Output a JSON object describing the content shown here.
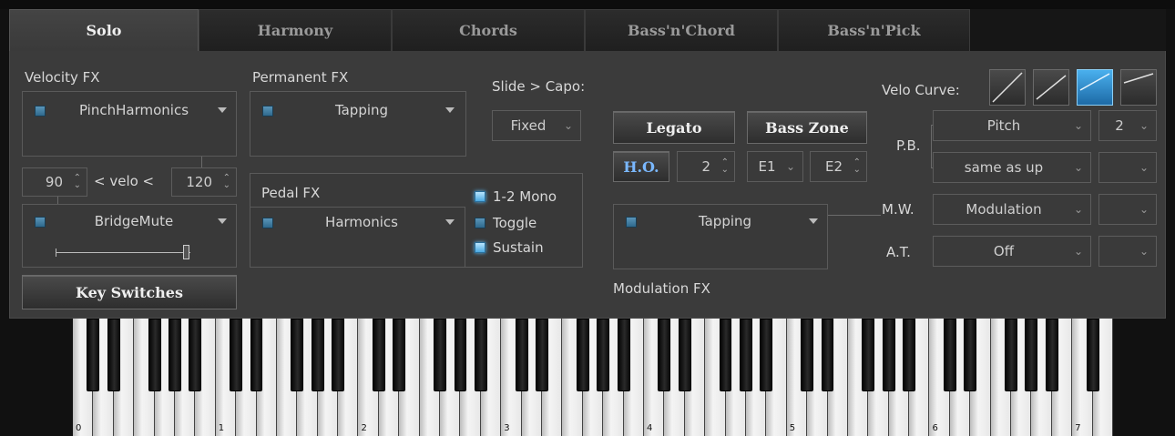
{
  "tabs": [
    {
      "label": "Solo",
      "active": true
    },
    {
      "label": "Harmony",
      "active": false
    },
    {
      "label": "Chords",
      "active": false
    },
    {
      "label": "Bass'n'Chord",
      "active": false
    },
    {
      "label": "Bass'n'Pick",
      "active": false
    }
  ],
  "velocity_fx": {
    "title": "Velocity FX",
    "upper_fx": "PinchHarmonics",
    "low_velo": "90",
    "velo_text": "< velo <",
    "high_velo": "120",
    "lower_fx": "BridgeMute",
    "slider_value": 1.0
  },
  "key_switches_label": "Key Switches",
  "permanent_fx": {
    "title": "Permanent FX",
    "value": "Tapping"
  },
  "slide_capo": {
    "title": "Slide > Capo:",
    "value": "Fixed"
  },
  "pedal_fx": {
    "title": "Pedal FX",
    "value": "Harmonics",
    "options": [
      {
        "label": "1-2 Mono",
        "on": true
      },
      {
        "label": "Toggle",
        "on": false
      },
      {
        "label": "Sustain",
        "on": true
      }
    ]
  },
  "legato_label": "Legato",
  "bass_zone_label": "Bass Zone",
  "ho": {
    "label": "H.O.",
    "value": "2"
  },
  "bass_zone": {
    "e1": "E1",
    "e2": "E2"
  },
  "modulation_fx": {
    "title": "Modulation FX",
    "value": "Tapping"
  },
  "velo_curve": {
    "title": "Velo Curve:",
    "selected_index": 2
  },
  "controllers": {
    "pb_label": "P.B.",
    "pitch": "Pitch",
    "pitch_range": "2",
    "down": "same as up",
    "down_range": "",
    "mw_label": "M.W.",
    "mw_value": "Modulation",
    "mw_range": "",
    "at_label": "A.T.",
    "at_value": "Off",
    "at_range": ""
  },
  "keyboard": {
    "octave_labels": [
      "0",
      "1",
      "2",
      "3",
      "4",
      "5",
      "6",
      "7"
    ]
  },
  "icons": {
    "dropdown": "chevron-down-icon",
    "combo": "triangle-down-icon",
    "spinner": "up-down-arrows-icon"
  },
  "colors": {
    "panel": "#3b3b3b",
    "led": "#3a7ea8",
    "curve_active": "#2a8ad0"
  }
}
